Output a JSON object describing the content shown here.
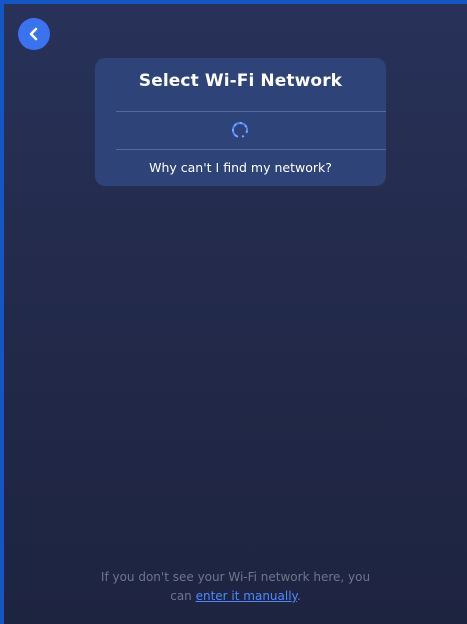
{
  "header": {
    "back_icon": "chevron-left-icon",
    "accent_color": "#3a73f0"
  },
  "card": {
    "title": "Select Wi-Fi Network",
    "loading_icon": "spinner-icon",
    "help_link": "Why can't I find my network?"
  },
  "footer": {
    "line1": "If you don't see your Wi-Fi network here, you",
    "line2_prefix": "can ",
    "manual_link": "enter it manually",
    "line2_suffix": ".",
    "link_color": "#4d88ff"
  }
}
